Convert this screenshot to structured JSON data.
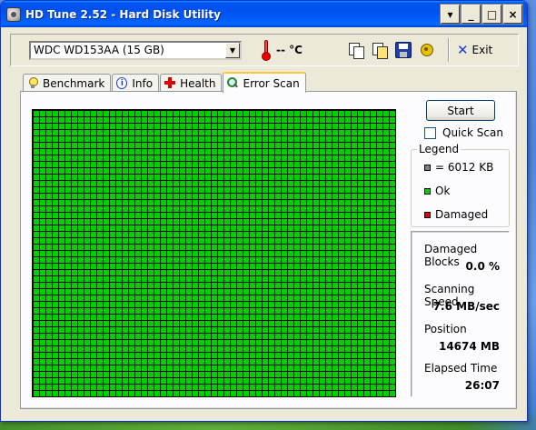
{
  "window": {
    "title": "HD Tune 2.52 - Hard Disk Utility"
  },
  "caption_buttons": {
    "dropdown": "▾",
    "minimize": "_",
    "maximize": "□",
    "close": "×"
  },
  "toolbar": {
    "drive": "WDC WD153AA (15 GB)",
    "temperature": "-- °C",
    "exit_label": "Exit",
    "exit_mark": "✕"
  },
  "tabs": [
    {
      "label": "Benchmark",
      "icon": "bulb-icon"
    },
    {
      "label": "Info",
      "icon": "info-icon"
    },
    {
      "label": "Health",
      "icon": "health-cross-icon"
    },
    {
      "label": "Error Scan",
      "icon": "magnifier-icon",
      "active": true
    }
  ],
  "error_scan": {
    "start_label": "Start",
    "quick_scan_label": "Quick Scan",
    "quick_scan_checked": false,
    "legend": {
      "title": "Legend",
      "block_size": "= 6012 KB",
      "ok": "Ok",
      "damaged": "Damaged"
    },
    "stats": {
      "damaged_blocks_label": "Damaged Blocks",
      "damaged_blocks_value": "0.0 %",
      "scanning_speed_label": "Scanning Speed",
      "scanning_speed_value": "7.6 MB/sec",
      "position_label": "Position",
      "position_value": "14674 MB",
      "elapsed_label": "Elapsed Time",
      "elapsed_value": "26:07"
    }
  },
  "colors": {
    "ok": "#00d000",
    "damaged": "#e00000",
    "block": "#808080",
    "title_bar": "#0050ee"
  }
}
